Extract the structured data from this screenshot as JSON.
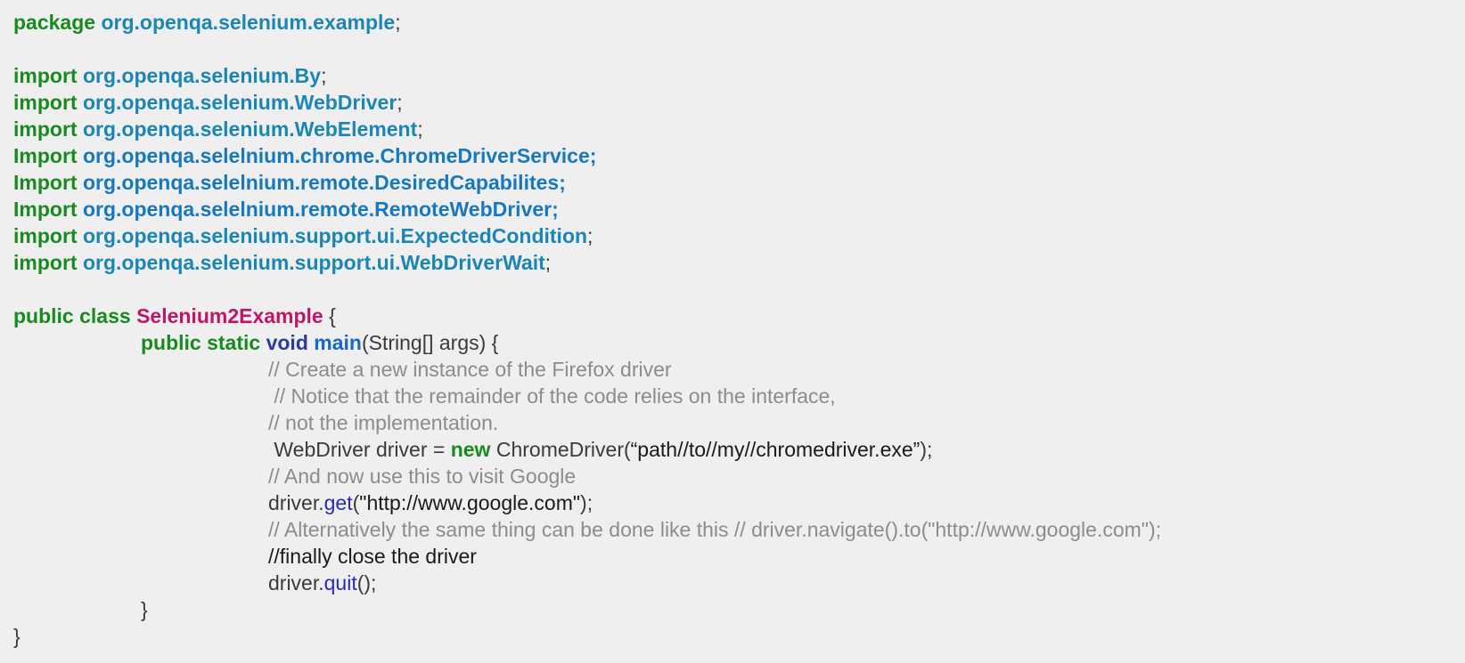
{
  "lines": [
    [
      {
        "t": "package",
        "c": "kw"
      },
      {
        "t": " ",
        "c": "plain"
      },
      {
        "t": "org.openqa.selenium.example",
        "c": "pkg"
      },
      {
        "t": ";",
        "c": "plain"
      }
    ],
    [],
    [
      {
        "t": "import",
        "c": "kw"
      },
      {
        "t": " ",
        "c": "plain"
      },
      {
        "t": "org.openqa.selenium.By",
        "c": "pkg"
      },
      {
        "t": ";",
        "c": "plain"
      }
    ],
    [
      {
        "t": "import",
        "c": "kw"
      },
      {
        "t": " ",
        "c": "plain"
      },
      {
        "t": "org.openqa.selenium.WebDriver",
        "c": "pkg"
      },
      {
        "t": ";",
        "c": "plain"
      }
    ],
    [
      {
        "t": "import",
        "c": "kw"
      },
      {
        "t": " ",
        "c": "plain"
      },
      {
        "t": "org.openqa.selenium.WebElement",
        "c": "pkg"
      },
      {
        "t": ";",
        "c": "plain"
      }
    ],
    [
      {
        "t": "Import",
        "c": "kw"
      },
      {
        "t": " ",
        "c": "plain"
      },
      {
        "t": "org.openqa.selelnium.chrome.ChromeDriverService;",
        "c": "pkg2"
      }
    ],
    [
      {
        "t": "Import",
        "c": "kw"
      },
      {
        "t": " ",
        "c": "plain"
      },
      {
        "t": "org.openqa.selelnium.remote.DesiredCapabilites;",
        "c": "pkg2"
      }
    ],
    [
      {
        "t": "Import",
        "c": "kw"
      },
      {
        "t": " ",
        "c": "plain"
      },
      {
        "t": "org.openqa.selelnium.remote.RemoteWebDriver;",
        "c": "pkg2"
      }
    ],
    [
      {
        "t": "import",
        "c": "kw"
      },
      {
        "t": " ",
        "c": "plain"
      },
      {
        "t": "org.openqa.selenium.support.ui.ExpectedCondition",
        "c": "pkg"
      },
      {
        "t": ";",
        "c": "plain"
      }
    ],
    [
      {
        "t": "import",
        "c": "kw"
      },
      {
        "t": " ",
        "c": "plain"
      },
      {
        "t": "org.openqa.selenium.support.ui.WebDriverWait",
        "c": "pkg"
      },
      {
        "t": ";",
        "c": "plain"
      }
    ],
    [],
    [
      {
        "t": "public class",
        "c": "kw"
      },
      {
        "t": " ",
        "c": "plain"
      },
      {
        "t": "Selenium2Example",
        "c": "cls"
      },
      {
        "t": " {",
        "c": "plain"
      }
    ],
    [
      {
        "t": "\t",
        "c": "plain"
      },
      {
        "t": "public static",
        "c": "kw"
      },
      {
        "t": " ",
        "c": "plain"
      },
      {
        "t": "void",
        "c": "kw2"
      },
      {
        "t": " ",
        "c": "plain"
      },
      {
        "t": "main",
        "c": "mth"
      },
      {
        "t": "(String[] args) {",
        "c": "plain"
      }
    ],
    [
      {
        "t": "\t\t",
        "c": "plain"
      },
      {
        "t": "// Create a new instance of the Firefox driver",
        "c": "cmt"
      }
    ],
    [
      {
        "t": "\t\t",
        "c": "plain"
      },
      {
        "t": " // Notice that the remainder of the code relies on the interface,",
        "c": "cmt"
      }
    ],
    [
      {
        "t": "\t\t",
        "c": "plain"
      },
      {
        "t": "// not the implementation.",
        "c": "cmt"
      }
    ],
    [
      {
        "t": "\t\t",
        "c": "plain"
      },
      {
        "t": " WebDriver driver = ",
        "c": "plain"
      },
      {
        "t": "new",
        "c": "kw"
      },
      {
        "t": " ChromeDriver(",
        "c": "plain"
      },
      {
        "t": "“path//to//my//chromedriver.exe”",
        "c": "dark"
      },
      {
        "t": ");",
        "c": "plain"
      }
    ],
    [
      {
        "t": "\t\t",
        "c": "plain"
      },
      {
        "t": "// And now use this to visit Google",
        "c": "cmt"
      }
    ],
    [
      {
        "t": "\t\t",
        "c": "plain"
      },
      {
        "t": "driver.",
        "c": "plain"
      },
      {
        "t": "get",
        "c": "mth2"
      },
      {
        "t": "(",
        "c": "plain"
      },
      {
        "t": "\"http://www.google.com\"",
        "c": "dark"
      },
      {
        "t": ");",
        "c": "plain"
      }
    ],
    [
      {
        "t": "\t\t",
        "c": "plain"
      },
      {
        "t": "// Alternatively the same thing can be done like this // driver.navigate().to(\"http://www.google.com\");",
        "c": "cmt"
      }
    ],
    [
      {
        "t": "\t\t",
        "c": "plain"
      },
      {
        "t": "//finally close the driver",
        "c": "dark"
      }
    ],
    [
      {
        "t": "\t\t",
        "c": "plain"
      },
      {
        "t": "driver.",
        "c": "plain"
      },
      {
        "t": "quit",
        "c": "mth2"
      },
      {
        "t": "();",
        "c": "plain"
      }
    ],
    [
      {
        "t": "\t",
        "c": "plain"
      },
      {
        "t": "}",
        "c": "plain"
      }
    ],
    [
      {
        "t": "}",
        "c": "plain"
      }
    ]
  ],
  "colors": {
    "background": "#efefef",
    "keyword": "#188a20",
    "package": "#1b86b4",
    "class_name": "#c0166a",
    "comment": "#8c8c8c"
  }
}
